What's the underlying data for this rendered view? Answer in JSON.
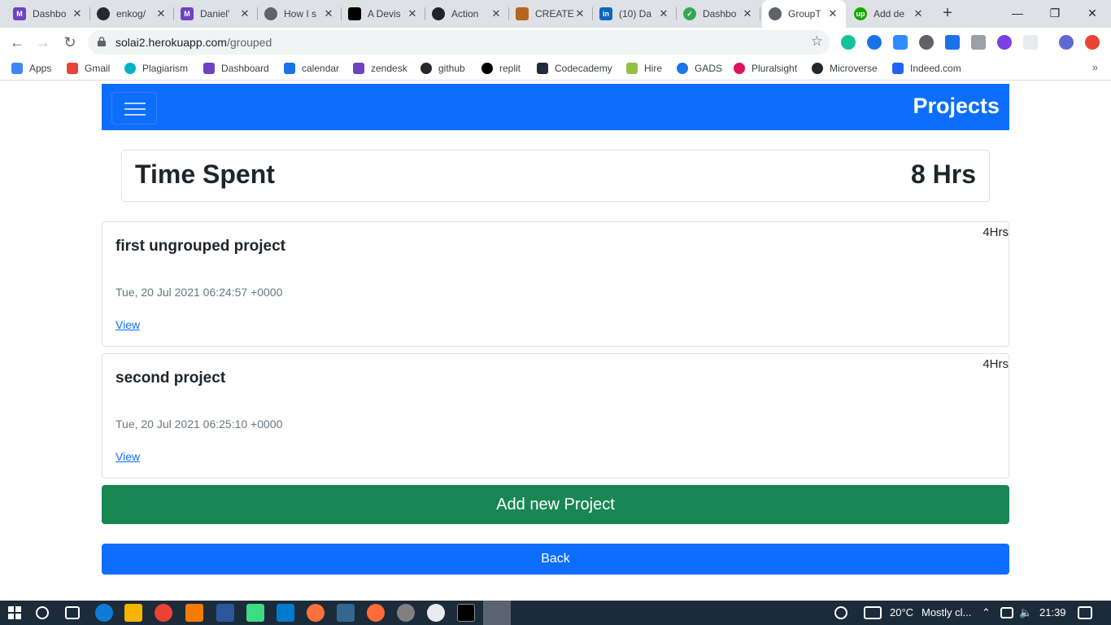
{
  "browser": {
    "tabs": [
      {
        "title": "Dashbo",
        "color": "#6f42c1",
        "glyph": "M"
      },
      {
        "title": "enkog/",
        "color": "#24292e",
        "glyph": ""
      },
      {
        "title": "Daniel'",
        "color": "#6f42c1",
        "glyph": "M"
      },
      {
        "title": "How I s",
        "color": "#5f6368",
        "glyph": ""
      },
      {
        "title": "A Devis",
        "color": "#000000",
        "glyph": ""
      },
      {
        "title": "Action",
        "color": "#20232a",
        "glyph": ""
      },
      {
        "title": "CREATE",
        "color": "#b5651d",
        "glyph": ""
      },
      {
        "title": "(10) Da",
        "color": "#0a66c2",
        "glyph": "in"
      },
      {
        "title": "Dashbo",
        "color": "#34a853",
        "glyph": ""
      },
      {
        "title": "GroupT",
        "color": "#5f6368",
        "glyph": "",
        "active": true
      },
      {
        "title": "Add de",
        "color": "#14a800",
        "glyph": "up"
      }
    ],
    "new_tab": "+",
    "window_controls": {
      "minimize": "—",
      "maximize": "❐",
      "close": "✕"
    },
    "address": {
      "domain": "solai2.herokuapp.com",
      "path": "/grouped"
    },
    "bookmarks": [
      {
        "label": "Apps",
        "color": "#4285f4"
      },
      {
        "label": "Gmail",
        "color": "#ea4335"
      },
      {
        "label": "Plagiarism",
        "color": "#00b3c4"
      },
      {
        "label": "Dashboard",
        "color": "#6f42c1"
      },
      {
        "label": "calendar",
        "color": "#1a73e8"
      },
      {
        "label": "zendesk",
        "color": "#6f42c1"
      },
      {
        "label": "github",
        "color": "#24292e"
      },
      {
        "label": "replit",
        "color": "#000000"
      },
      {
        "label": "Codecademy",
        "color": "#1f2d3d"
      },
      {
        "label": "Hire",
        "color": "#95bf47"
      },
      {
        "label": "GADS",
        "color": "#1a73e8"
      },
      {
        "label": "Pluralsight",
        "color": "#e0115f"
      },
      {
        "label": "Microverse",
        "color": "#24292e"
      },
      {
        "label": "Indeed.com",
        "color": "#2164f3"
      }
    ],
    "bookmarks_more": "»"
  },
  "app": {
    "nav_title": "Projects",
    "time_spent_label": "Time Spent",
    "time_spent_value": "8 Hrs",
    "projects": [
      {
        "hours": "4Hrs",
        "title": "first ungrouped project",
        "date": "Tue, 20 Jul 2021 06:24:57 +0000",
        "link": "View"
      },
      {
        "hours": "4Hrs",
        "title": "second project",
        "date": "Tue, 20 Jul 2021 06:25:10 +0000",
        "link": "View"
      }
    ],
    "add_button": "Add new Project",
    "back_button": "Back"
  },
  "taskbar": {
    "temperature": "20°C",
    "weather": "Mostly cl...",
    "time": "21:39"
  }
}
